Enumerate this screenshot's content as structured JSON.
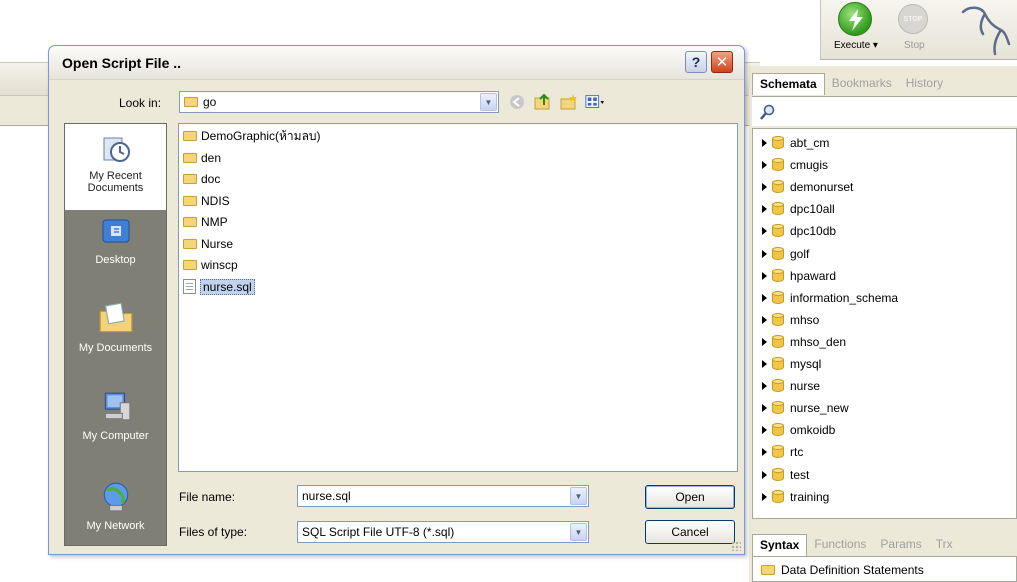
{
  "app": {
    "execute_label": "Execute ▾",
    "stop_label": "Stop",
    "stop_icon_text": "STOP"
  },
  "schemata": {
    "tabs": [
      "Schemata",
      "Bookmarks",
      "History"
    ],
    "active_tab": "Schemata",
    "items": [
      "abt_cm",
      "cmugis",
      "demonurset",
      "dpc10all",
      "dpc10db",
      "golf",
      "hpaward",
      "information_schema",
      "mhso",
      "mhso_den",
      "mysql",
      "nurse",
      "nurse_new",
      "omkoidb",
      "rtc",
      "test",
      "training"
    ]
  },
  "syntax": {
    "tabs": [
      "Syntax",
      "Functions",
      "Params",
      "Trx"
    ],
    "active_tab": "Syntax",
    "items": [
      "Data Definition Statements"
    ]
  },
  "dialog": {
    "title": "Open Script File ..",
    "help_label": "?",
    "close_label": "✕",
    "look_in_label": "Look in:",
    "look_in_value": "go",
    "places": [
      "My Recent Documents",
      "Desktop",
      "My Documents",
      "My Computer",
      "My Network"
    ],
    "files": [
      {
        "name": "DemoGraphic(ห้ามลบ)",
        "type": "folder"
      },
      {
        "name": "den",
        "type": "folder"
      },
      {
        "name": "doc",
        "type": "folder"
      },
      {
        "name": "NDIS",
        "type": "folder"
      },
      {
        "name": "NMP",
        "type": "folder"
      },
      {
        "name": "Nurse",
        "type": "folder"
      },
      {
        "name": "winscp",
        "type": "folder"
      },
      {
        "name": "nurse.sql",
        "type": "file",
        "selected": true
      }
    ],
    "file_name_label": "File name:",
    "file_name_value": "nurse.sql",
    "file_type_label": "Files of type:",
    "file_type_value": "SQL Script File UTF-8 (*.sql)",
    "open_label": "Open",
    "cancel_label": "Cancel"
  },
  "colors": {
    "selection": "#c1d2ee",
    "places_bar": "#7f7f76",
    "folder": "#f5d57a",
    "db_icon": "#f0c64a"
  }
}
